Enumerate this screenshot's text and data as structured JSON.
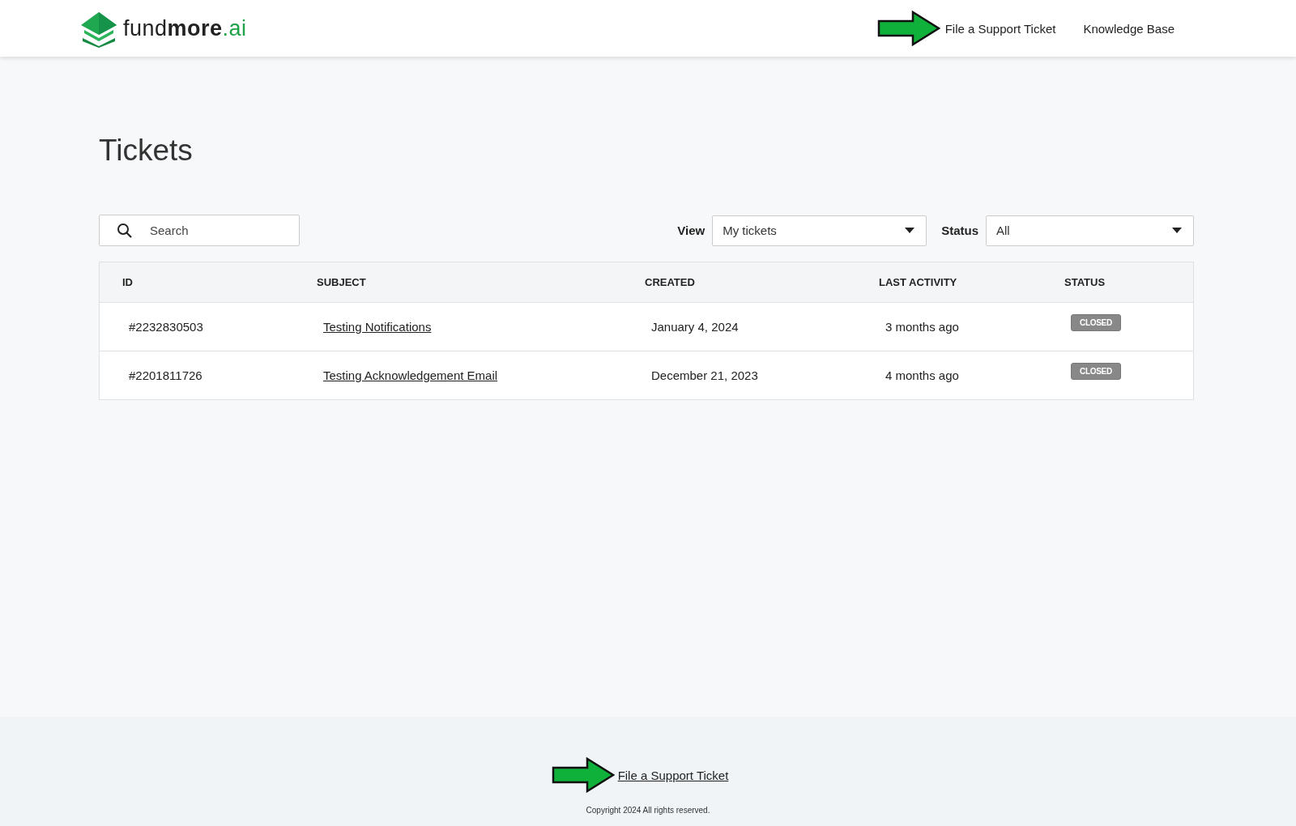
{
  "header": {
    "logo": {
      "light": "fund",
      "bold": "more",
      "accent": ".ai"
    },
    "nav": [
      {
        "label": "File a Support Ticket",
        "annotated": true
      },
      {
        "label": "Knowledge Base",
        "annotated": false
      }
    ]
  },
  "page_title": "Tickets",
  "search": {
    "placeholder": "Search"
  },
  "filters": [
    {
      "label": "View",
      "value": "My tickets"
    },
    {
      "label": "Status",
      "value": "All"
    }
  ],
  "table": {
    "columns": [
      "ID",
      "SUBJECT",
      "CREATED",
      "LAST ACTIVITY",
      "STATUS"
    ],
    "rows": [
      {
        "id": "#2232830503",
        "subject": "Testing Notifications",
        "created": "January 4, 2024",
        "last_activity": "3 months ago",
        "status": "CLOSED"
      },
      {
        "id": "#2201811726",
        "subject": "Testing Acknowledgement Email",
        "created": "December 21, 2023",
        "last_activity": "4 months ago",
        "status": "CLOSED"
      }
    ]
  },
  "footer": {
    "link": {
      "label": "File a Support Ticket",
      "annotated": true
    },
    "copyright": "Copyright 2024 All rights reserved."
  }
}
